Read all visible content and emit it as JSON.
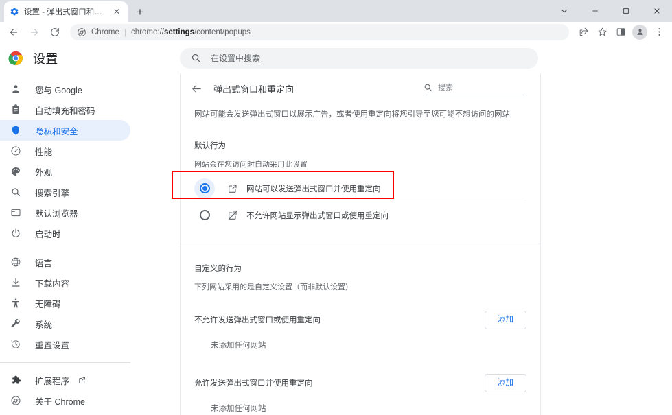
{
  "window": {
    "controls": [
      {
        "name": "chevron-down",
        "glyph": "⌄"
      },
      {
        "name": "minimize",
        "glyph": "–"
      },
      {
        "name": "maximize",
        "glyph": "□"
      },
      {
        "name": "close",
        "glyph": "✕"
      }
    ]
  },
  "tab": {
    "title": "设置 - 弹出式窗口和重定向",
    "close_label": "✕",
    "new_tab_label": "+",
    "favicon": "settings-gear-favicon"
  },
  "toolbar": {
    "back_label": "←",
    "forward_label": "→",
    "reload_label": "⟳",
    "omnibox": {
      "scheme_label": "Chrome",
      "separator": "|",
      "url_prefix": "chrome://",
      "url_bold": "settings",
      "url_suffix": "/content/popups",
      "full_url": "chrome://settings/content/popups"
    },
    "actions": [
      {
        "name": "share-icon"
      },
      {
        "name": "bookmark-star-icon"
      },
      {
        "name": "side-panel-icon"
      },
      {
        "name": "profile-avatar"
      },
      {
        "name": "three-dot-menu-icon"
      }
    ]
  },
  "settings": {
    "brand_title": "设置",
    "logo": "chrome-logo",
    "search": {
      "placeholder": "在设置中搜索",
      "icon": "search-icon"
    }
  },
  "sidebar": {
    "items": [
      {
        "label": "您与 Google",
        "icon": "person-icon",
        "selected": false
      },
      {
        "label": "自动填充和密码",
        "icon": "clipboard-icon",
        "selected": false
      },
      {
        "label": "隐私和安全",
        "icon": "shield-icon",
        "selected": true
      },
      {
        "label": "性能",
        "icon": "speedometer-icon",
        "selected": false
      },
      {
        "label": "外观",
        "icon": "palette-icon",
        "selected": false
      },
      {
        "label": "搜索引擎",
        "icon": "search-icon",
        "selected": false
      },
      {
        "label": "默认浏览器",
        "icon": "browser-window-icon",
        "selected": false
      },
      {
        "label": "启动时",
        "icon": "power-icon",
        "selected": false
      }
    ],
    "items2": [
      {
        "label": "语言",
        "icon": "globe-icon",
        "selected": false
      },
      {
        "label": "下载内容",
        "icon": "download-icon",
        "selected": false
      },
      {
        "label": "无障碍",
        "icon": "accessibility-icon",
        "selected": false
      },
      {
        "label": "系统",
        "icon": "wrench-icon",
        "selected": false
      },
      {
        "label": "重置设置",
        "icon": "history-restore-icon",
        "selected": false
      }
    ],
    "items3": [
      {
        "label": "扩展程序",
        "icon": "puzzle-piece-icon",
        "external": true
      },
      {
        "label": "关于 Chrome",
        "icon": "chrome-circle-icon",
        "external": false
      }
    ]
  },
  "main": {
    "back_label": "←",
    "title": "弹出式窗口和重定向",
    "search": {
      "placeholder": "搜索",
      "icon": "search-icon"
    },
    "description": "网站可能会发送弹出式窗口以展示广告，或者使用重定向将您引导至您可能不想访问的网站",
    "default_behavior": {
      "heading": "默认行为",
      "subtitle": "网站会在您访问时自动采用此设置",
      "options": [
        {
          "label": "网站可以发送弹出式窗口并使用重定向",
          "icon": "open-in-new-icon",
          "selected": true,
          "highlighted": true
        },
        {
          "label": "不允许网站显示弹出式窗口或使用重定向",
          "icon": "open-in-new-blocked-icon",
          "selected": false,
          "highlighted": false
        }
      ]
    },
    "custom_behavior": {
      "heading": "自定义的行为",
      "subtitle": "下列网站采用的是自定义设置（而非默认设置）",
      "groups": [
        {
          "label": "不允许发送弹出式窗口或使用重定向",
          "add_label": "添加",
          "empty_text": "未添加任何网站"
        },
        {
          "label": "允许发送弹出式窗口并使用重定向",
          "add_label": "添加",
          "empty_text": "未添加任何网站"
        }
      ]
    }
  },
  "colors": {
    "accent": "#1a73e8",
    "accent_bg": "#e8f0fe",
    "highlight_border": "#ff0000",
    "tabstrip_bg": "#dee1e6",
    "omnibox_bg": "#f1f3f4",
    "text_primary": "#202124",
    "text_secondary": "#5f6368"
  }
}
